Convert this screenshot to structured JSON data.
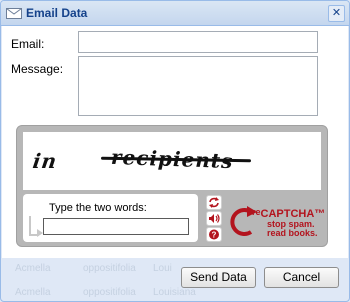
{
  "window": {
    "title": "Email Data",
    "close_glyph": "✕"
  },
  "form": {
    "email_label": "Email:",
    "email_value": "",
    "message_label": "Message:",
    "message_value": ""
  },
  "recaptcha": {
    "challenge_words": [
      "in",
      "recipients"
    ],
    "prompt": "Type the two words:",
    "response_value": "",
    "buttons": [
      "refresh-icon",
      "audio-icon",
      "help-icon"
    ],
    "logo_text": "CAPTCHA™",
    "logo_prefix": "re",
    "tagline_1": "stop spam.",
    "tagline_2": "read books.",
    "brand_color": "#b3141e"
  },
  "background_text": [
    "Acmella",
    "oppositifolia",
    "Loui",
    "Acmella",
    "oppositifolia",
    "Louisiana"
  ],
  "footer": {
    "send_label": "Send Data",
    "cancel_label": "Cancel"
  },
  "colors": {
    "titlebar_text": "#15428b",
    "frame": "#dfe8f6",
    "border": "#99bbe8"
  }
}
